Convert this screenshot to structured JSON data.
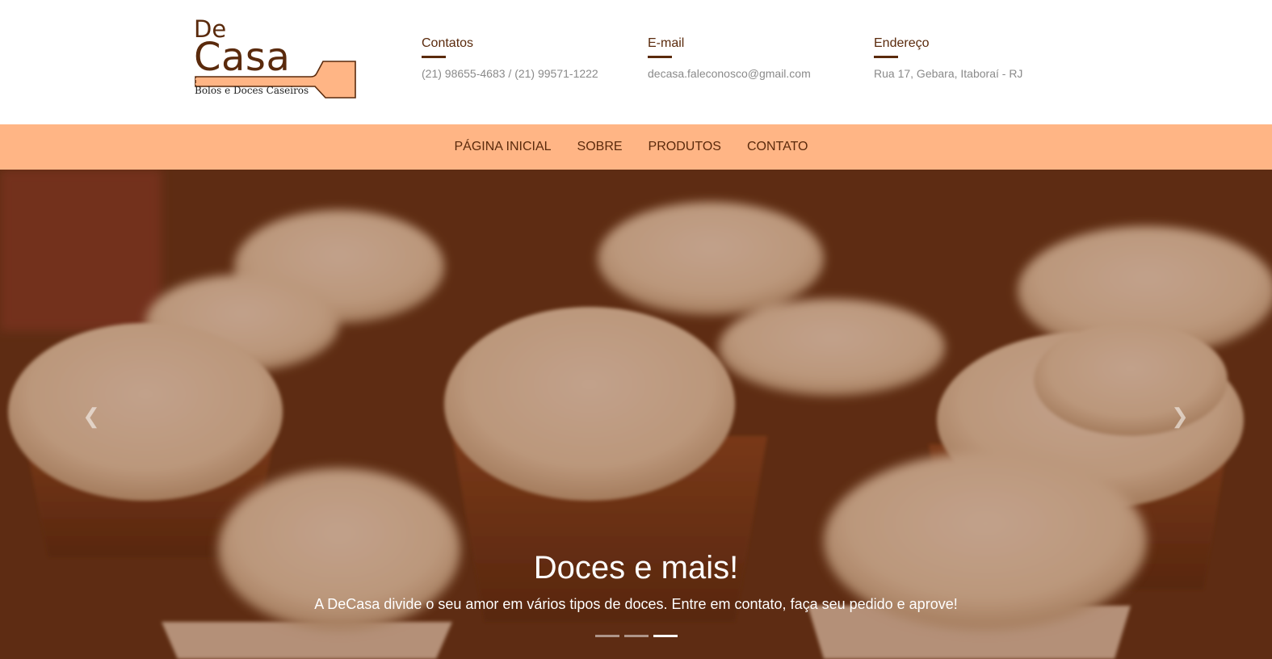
{
  "brand": {
    "logo_de": "De",
    "logo_casa": "Casa",
    "logo_subtitle": "Bolos e Doces Caseiros",
    "brand_color": "#5a2a0c",
    "spoon_color": "#ffb585"
  },
  "header": {
    "contacts": [
      {
        "title": "Contatos",
        "value": "(21) 98655-4683 / (21) 99571-1222"
      },
      {
        "title": "E-mail",
        "value": "decasa.faleconosco@gmail.com"
      },
      {
        "title": "Endereço",
        "value": "Rua 17, Gebara, Itaboraí - RJ"
      }
    ]
  },
  "nav": {
    "background": "#ffb585",
    "items": [
      {
        "label": "PÁGINA INICIAL"
      },
      {
        "label": "SOBRE"
      },
      {
        "label": "PRODUTOS"
      },
      {
        "label": "CONTATO"
      }
    ]
  },
  "hero": {
    "title": "Doces e mais!",
    "text": "A DeCasa divide o seu amor em vários tipos de doces. Entre em contato, faça seu pedido e aprove!",
    "prev_icon": "chevron-left-icon",
    "next_icon": "chevron-right-icon",
    "slides_count": 3,
    "active_slide": 3
  }
}
